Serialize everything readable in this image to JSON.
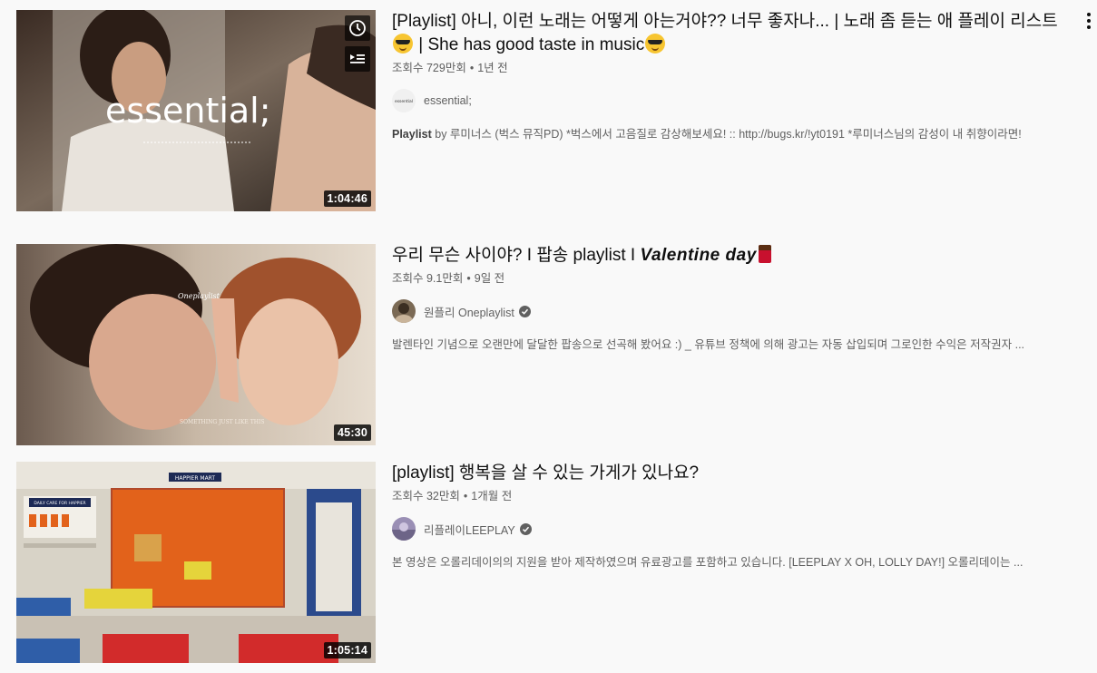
{
  "results": [
    {
      "title_main": "[Playlist] 아니, 이런 노래는 어떻게 아는거야?? 너무 좋자나... | 노래 좀 듣는 애 플레이 리스트",
      "title_mid": " | She has good taste in music",
      "views": "조회수 729만회",
      "age": "1년 전",
      "channel": "essential;",
      "avatar_text": "essential",
      "desc_bold": "Playlist",
      "desc": " by 루미너스 (벅스 뮤직PD) *벅스에서 고음질로 감상해보세요! :: http://bugs.kr/!yt0191 *루미너스님의 감성이 내 취향이라면!",
      "duration": "1:04:46",
      "thumb_text": "essential;"
    },
    {
      "title_main": "우리 무슨 사이야? I 팝송 playlist I ",
      "title_italic": "Valentine day",
      "views": "조회수 9.1만회",
      "age": "9일 전",
      "channel": "원플리 Oneplaylist",
      "desc": "발렌타인 기념으로 오랜만에 달달한 팝송으로 선곡해 봤어요 :) _ 유튜브 정책에 의해 광고는 자동 삽입되며 그로인한 수익은 저작권자 ...",
      "duration": "45:30",
      "thumb_text": "Oneplaylist",
      "thumb_caption": "SOMETHING JUST LIKE THIS"
    },
    {
      "title_main": "[playlist] 행복을 살 수 있는 가게가 있나요?",
      "views": "조회수 32만회",
      "age": "1개월 전",
      "channel": "리플레이LEEPLAY",
      "desc": "본 영상은 오롤리데이의의 지원을 받아 제작하였으며 유료광고를 포함하고 있습니다. [LEEPLAY X OH, LOLLY DAY!] 오롤리데이는 ...",
      "duration": "1:05:14",
      "thumb_sign": "HAPPIER MART",
      "thumb_sign2": "DAILY CARE FOR HAPPIER"
    }
  ],
  "dot": "•"
}
